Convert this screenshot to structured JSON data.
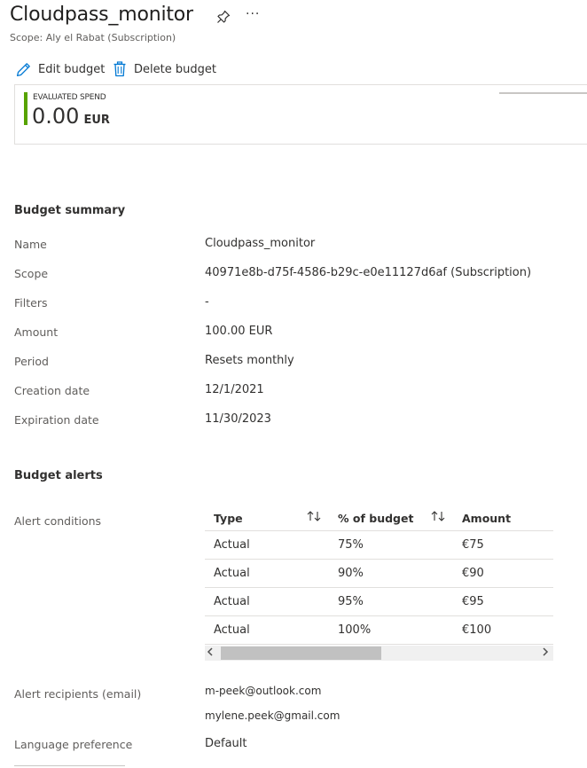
{
  "header": {
    "title": "Cloudpass_monitor",
    "more_label": "···",
    "subtitle": "Scope: Aly el Rabat (Subscription)"
  },
  "toolbar": {
    "edit_label": "Edit budget",
    "delete_label": "Delete budget"
  },
  "spend_card": {
    "label": "EVALUATED SPEND",
    "amount": "0.00",
    "currency": "EUR",
    "accent_color": "#57a300"
  },
  "summary": {
    "heading": "Budget summary",
    "rows": [
      {
        "label": "Name",
        "value": "Cloudpass_monitor"
      },
      {
        "label": "Scope",
        "value": "40971e8b-d75f-4586-b29c-e0e11127d6af (Subscription)"
      },
      {
        "label": "Filters",
        "value": "-"
      },
      {
        "label": "Amount",
        "value": "100.00 EUR"
      },
      {
        "label": "Period",
        "value": "Resets monthly"
      },
      {
        "label": "Creation date",
        "value": "12/1/2021"
      },
      {
        "label": "Expiration date",
        "value": "11/30/2023"
      }
    ]
  },
  "alerts": {
    "heading": "Budget alerts",
    "conditions_label": "Alert conditions",
    "columns": [
      "Type",
      "% of budget",
      "Amount"
    ],
    "rows": [
      {
        "type": "Actual",
        "percent": "75%",
        "amount": "€75"
      },
      {
        "type": "Actual",
        "percent": "90%",
        "amount": "€90"
      },
      {
        "type": "Actual",
        "percent": "95%",
        "amount": "€95"
      },
      {
        "type": "Actual",
        "percent": "100%",
        "amount": "€100"
      }
    ],
    "recipients_label": "Alert recipients (email)",
    "recipients": [
      "m-peek@outlook.com",
      "mylene.peek@gmail.com"
    ],
    "language_label": "Language preference",
    "language_value": "Default"
  }
}
